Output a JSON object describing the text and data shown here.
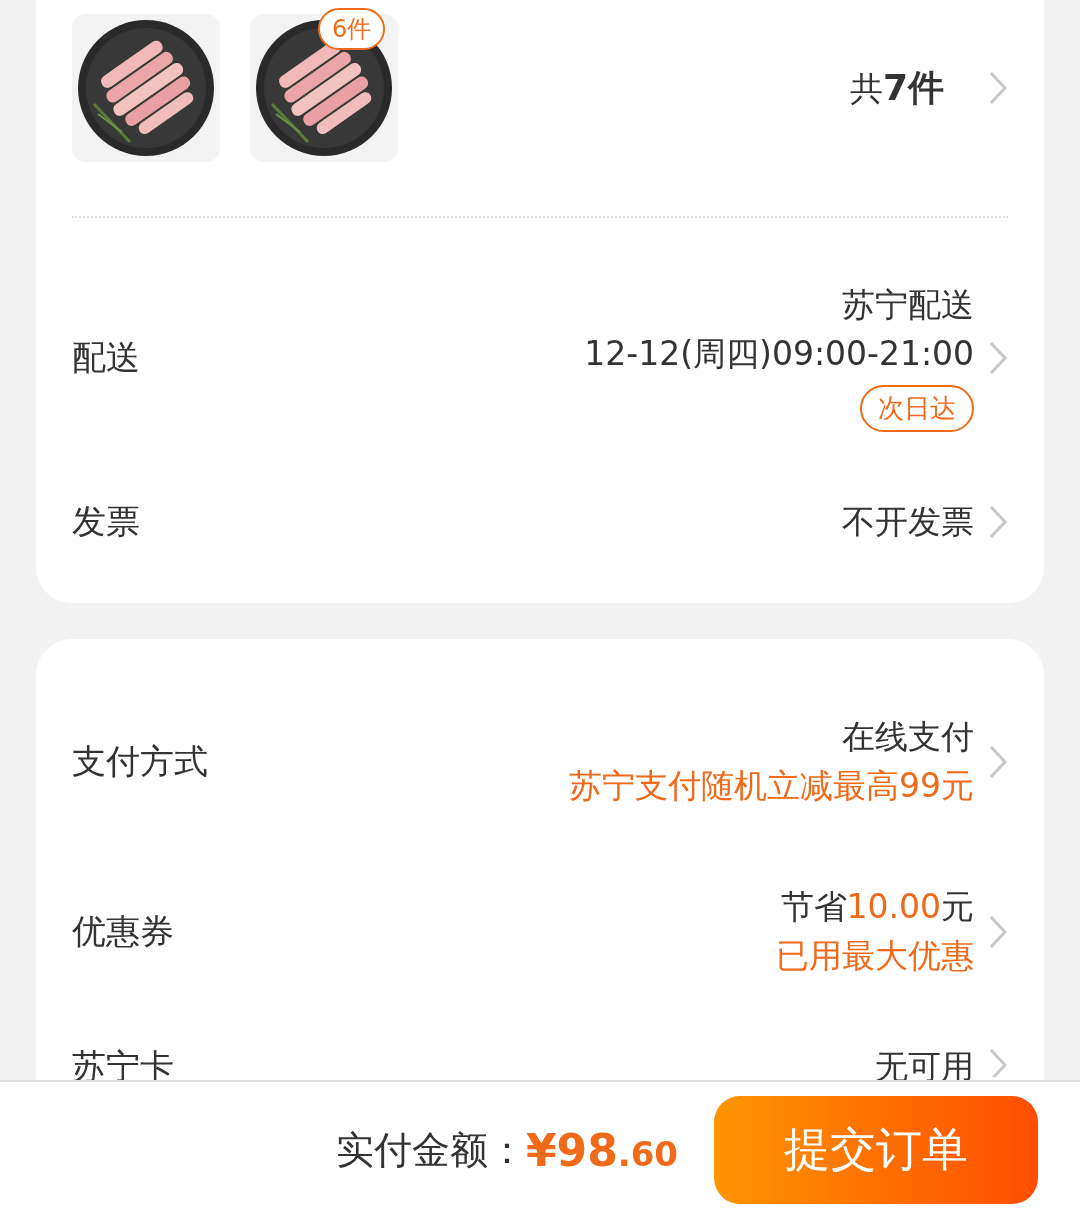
{
  "goods": {
    "thumbnails": [
      {
        "kind": "picture"
      },
      {
        "kind": "picture",
        "badge": "6件"
      }
    ],
    "total": {
      "prefix": "共",
      "count": "7件"
    }
  },
  "delivery": {
    "label": "配送",
    "carrier": "苏宁配送",
    "time": "12-12(周四)09:00-21:00",
    "tag": "次日达"
  },
  "invoice": {
    "label": "发票",
    "value": "不开发票"
  },
  "payment": {
    "label": "支付方式",
    "value": "在线支付",
    "promo": "苏宁支付随机立减最高99元"
  },
  "coupon": {
    "label": "优惠券",
    "saving": [
      {
        "text": "节省",
        "highlight": false
      },
      {
        "text": "10.00",
        "highlight": true
      },
      {
        "text": "元",
        "highlight": false
      }
    ],
    "note": "已用最大优惠"
  },
  "card": {
    "label": "苏宁卡",
    "value": "无可用"
  },
  "footer": {
    "label": "实付金额：",
    "price": "¥98.60",
    "submit": "提交订单"
  }
}
